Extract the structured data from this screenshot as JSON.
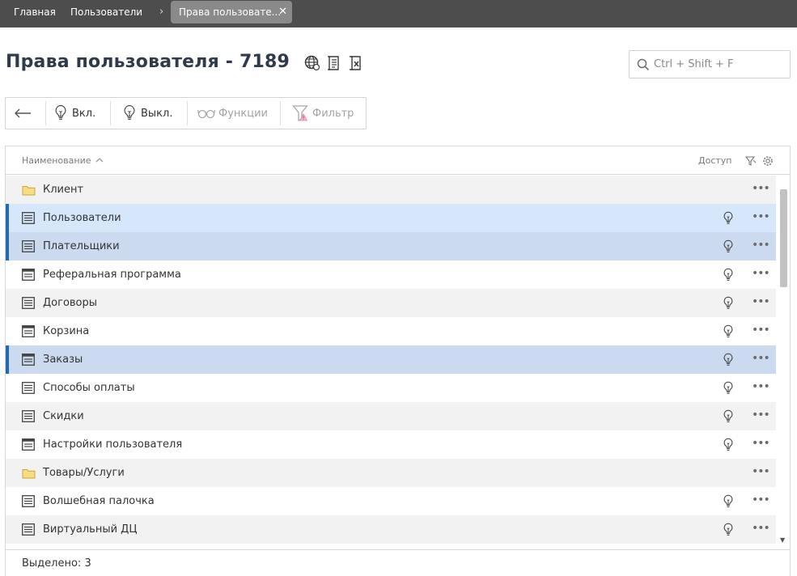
{
  "topbar": {
    "crumbs": [
      "Главная",
      "Пользователи"
    ],
    "active_tab": "Права пользовате...",
    "close_glyph": "✕",
    "separator": "›"
  },
  "header": {
    "title": "Права пользователя - 7189",
    "icons": [
      "globe-icon",
      "document-list-icon",
      "excel-export-icon"
    ]
  },
  "search": {
    "placeholder": "Ctrl + Shift + F",
    "value": ""
  },
  "toolbar": {
    "back_icon": "arrow-left-icon",
    "on_label": "Вкл.",
    "off_label": "Выкл.",
    "functions_label": "Функции",
    "filter_label": "Фильтр"
  },
  "table": {
    "columns": {
      "name": "Наименование",
      "access": "Доступ"
    },
    "rows": [
      {
        "label": "Клиент",
        "icon": "folder-icon",
        "state": "normal",
        "has_bulb": false
      },
      {
        "label": "Пользователи",
        "icon": "list-icon",
        "state": "selected",
        "has_bulb": true
      },
      {
        "label": "Плательщики",
        "icon": "list-icon",
        "state": "selected",
        "has_bulb": true
      },
      {
        "label": "Реферальная программа",
        "icon": "form-icon",
        "state": "normal",
        "has_bulb": true
      },
      {
        "label": "Договоры",
        "icon": "list-icon",
        "state": "normal",
        "has_bulb": true
      },
      {
        "label": "Корзина",
        "icon": "form-icon",
        "state": "normal",
        "has_bulb": true
      },
      {
        "label": "Заказы",
        "icon": "form-icon",
        "state": "selected",
        "has_bulb": true
      },
      {
        "label": "Способы оплаты",
        "icon": "list-icon",
        "state": "normal",
        "has_bulb": true
      },
      {
        "label": "Скидки",
        "icon": "list-icon",
        "state": "normal",
        "has_bulb": true
      },
      {
        "label": "Настройки пользователя",
        "icon": "form-icon",
        "state": "normal",
        "has_bulb": true
      },
      {
        "label": "Товары/Услуги",
        "icon": "folder-icon",
        "state": "normal",
        "has_bulb": false
      },
      {
        "label": "Волшебная палочка",
        "icon": "list-icon",
        "state": "normal",
        "has_bulb": true
      },
      {
        "label": "Виртуальный ДЦ",
        "icon": "list-icon",
        "state": "normal",
        "has_bulb": true
      }
    ],
    "more_glyph": "•••",
    "footer": "Выделено: 3"
  },
  "colors": {
    "topbar": "#4d4d4d",
    "selected_marker": "#1f6ab0",
    "selected_row": "#d6e6fb",
    "folder": "#f5d67a"
  }
}
